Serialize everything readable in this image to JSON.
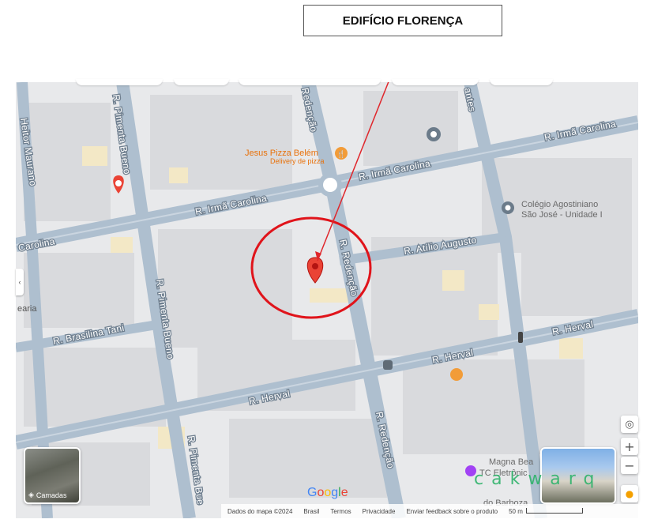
{
  "callout": {
    "label": "EDIFÍCIO FLORENÇA"
  },
  "streets": {
    "irma_carolina_top_right": "R. Irmã Carolina",
    "irma_carolina_mid": "R. Irmã Carolina",
    "irma_carolina_left": "R. Irmã Carolina",
    "carolina_far_left": "Carolina",
    "pimenta_bueno_top": "R. Pimenta Bueno",
    "pimenta_bueno_mid": "R. Pimenta Bueno",
    "pimenta_bueno_bottom": "R. Pimenta Bue",
    "redencao_mid": "R. Redenção",
    "redencao_bottom": "R. Redenção",
    "redencao_top": "Redenção",
    "atilio_augusto": "R. Atílio Augusto",
    "brasilina_tani": "R. Brasilina Tani",
    "herval_right": "R. Herval",
    "herval_mid": "R. Herval",
    "herval_bottom": "R. Herval",
    "heitor_maurano": "Heitor Maurano",
    "antes_top": "antes"
  },
  "pois": {
    "jesus_pizza_name": "Jesus Pizza Belém",
    "jesus_pizza_sub": "Delivery de pizza",
    "colegio_line1": "Colégio Agostiniano",
    "colegio_line2": "São José - Unidade I",
    "magna": "Magna Bea",
    "tc_eletronic": "TC Eletrônic",
    "barboza": "do Barboza",
    "edge_left": "earia"
  },
  "controls": {
    "layers_label": "Camadas",
    "zoom_in": "+",
    "zoom_out": "−",
    "locate": "◎"
  },
  "google_logo": [
    "G",
    "o",
    "o",
    "g",
    "l",
    "e"
  ],
  "attribution": {
    "data": "Dados do mapa ©2024",
    "country": "Brasil",
    "terms": "Termos",
    "privacy": "Privacidade",
    "feedback": "Enviar feedback sobre o produto",
    "scale": "50 m"
  },
  "watermark": "cakwarq",
  "colors": {
    "road": "#aebfcf",
    "block": "#dcdcde",
    "callout_arrow": "#e0262b",
    "circle": "#e0141b",
    "pin": "#ea4335",
    "poi_orange": "#f29c38"
  }
}
